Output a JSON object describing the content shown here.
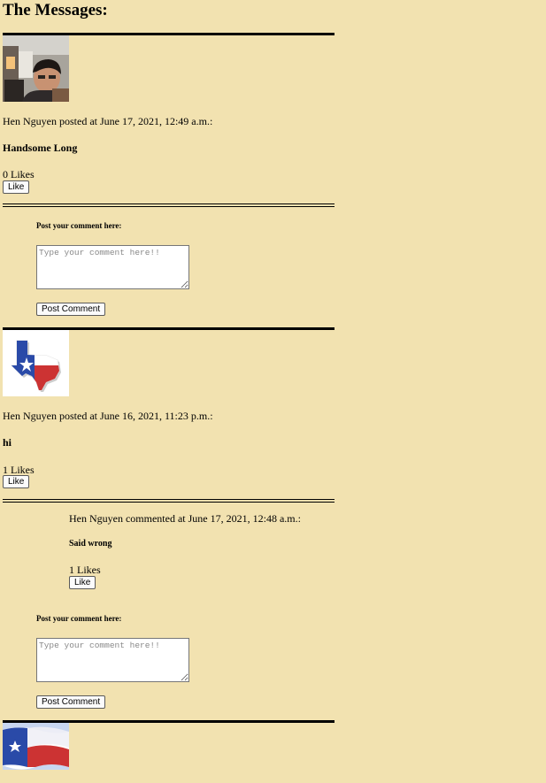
{
  "page": {
    "title": "The Messages:"
  },
  "posts": [
    {
      "meta": "Hen Nguyen posted at June 17, 2021, 12:49 a.m.:",
      "message": "Handsome Long",
      "likes": "0 Likes",
      "like_label": "Like",
      "comment_form": {
        "label": "Post your comment here:",
        "placeholder": "Type your comment here!!",
        "value": "",
        "submit_label": "Post Comment"
      }
    },
    {
      "meta": "Hen Nguyen posted at June 16, 2021, 11:23 p.m.:",
      "message": "hi",
      "likes": "1 Likes",
      "like_label": "Like",
      "comments": [
        {
          "meta": "Hen Nguyen commented at June 17, 2021, 12:48 a.m.:",
          "message": "Said wrong",
          "likes": "1 Likes",
          "like_label": "Like"
        }
      ],
      "comment_form": {
        "label": "Post your comment here:",
        "placeholder": "Type your comment here!!",
        "value": "",
        "submit_label": "Post Comment"
      }
    }
  ],
  "colors": {
    "background": "#f2e2b0",
    "texas_blue": "#2a4aa8",
    "texas_red": "#cc3333"
  }
}
